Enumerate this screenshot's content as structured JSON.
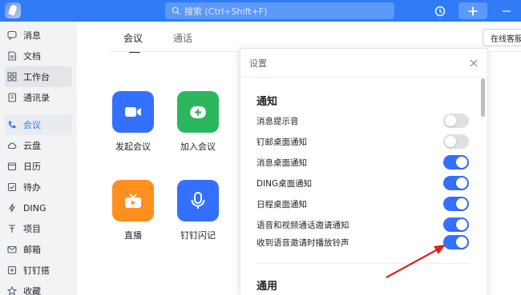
{
  "titlebar": {
    "search_placeholder": "搜索 (Ctrl+Shift+F)"
  },
  "sidebar": {
    "items": [
      {
        "label": "消息",
        "icon": "chat-icon"
      },
      {
        "label": "文档",
        "icon": "document-icon"
      },
      {
        "label": "工作台",
        "icon": "grid-icon"
      },
      {
        "label": "通讯录",
        "icon": "contacts-icon"
      },
      {
        "label": "会议",
        "icon": "phone-icon"
      },
      {
        "label": "云盘",
        "icon": "cloud-icon"
      },
      {
        "label": "日历",
        "icon": "calendar-icon"
      },
      {
        "label": "待办",
        "icon": "checkbox-icon"
      },
      {
        "label": "DING",
        "icon": "ding-icon"
      },
      {
        "label": "项目",
        "icon": "project-icon"
      },
      {
        "label": "邮箱",
        "icon": "mail-icon"
      },
      {
        "label": "钉钉搭",
        "icon": "build-icon"
      },
      {
        "label": "收藏",
        "icon": "star-icon"
      }
    ]
  },
  "main": {
    "tabs": [
      {
        "label": "会议"
      },
      {
        "label": "通话"
      }
    ],
    "online_button": "在线客服",
    "tiles": [
      {
        "label": "发起会议",
        "color": "#3370ff",
        "icon": "video-camera-icon"
      },
      {
        "label": "加入会议",
        "color": "#2cb65e",
        "icon": "join-plus-icon"
      },
      {
        "label": "直播",
        "color": "#ff8f1f",
        "icon": "live-tv-icon"
      },
      {
        "label": "钉钉闪记",
        "color": "#3370ff",
        "icon": "microphone-icon"
      }
    ]
  },
  "settings": {
    "title": "设置",
    "section_notify": "通知",
    "section_general": "通用",
    "rows": [
      {
        "label": "消息提示音",
        "on": false
      },
      {
        "label": "钉邮桌面通知",
        "on": false
      },
      {
        "label": "消息桌面通知",
        "on": true
      },
      {
        "label": "DING桌面通知",
        "on": true
      },
      {
        "label": "日程桌面通知",
        "on": true
      },
      {
        "label": "语音和视频通话邀请通知",
        "on": true
      },
      {
        "label": "收到语音邀请时播放铃声",
        "on": true
      }
    ]
  },
  "colors": {
    "brand": "#2f7cf6",
    "toggle_on": "#3370ff",
    "annotation_arrow": "#d9241c"
  }
}
